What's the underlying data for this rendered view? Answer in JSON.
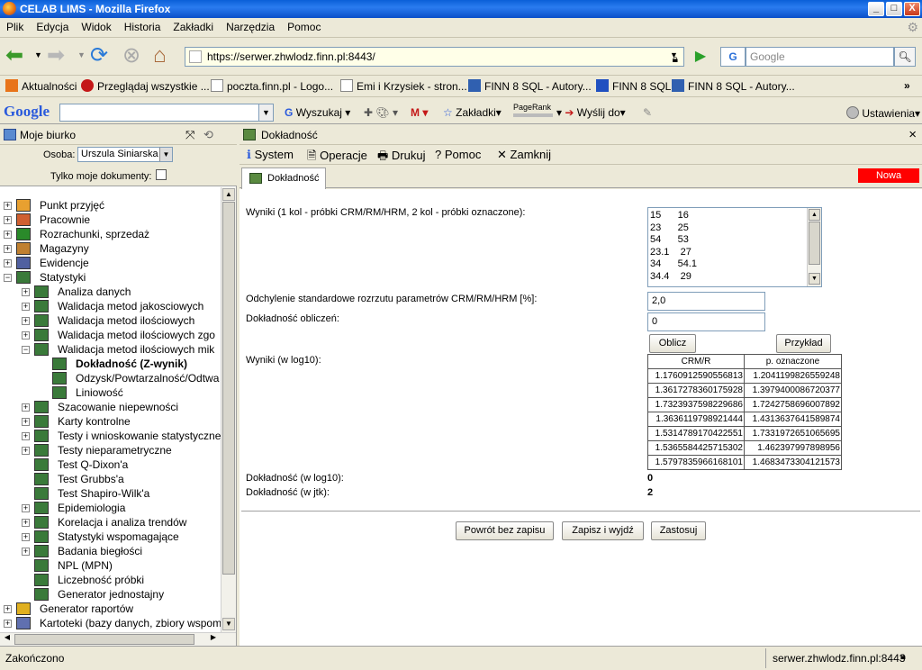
{
  "window": {
    "title": "CELAB LIMS - Mozilla Firefox",
    "min": "_",
    "max": "□",
    "close": "X"
  },
  "menu": [
    "Plik",
    "Edycja",
    "Widok",
    "Historia",
    "Zakładki",
    "Narzędzia",
    "Pomoc"
  ],
  "nav": {
    "url": "https://serwer.zhwlodz.finn.pl:8443/",
    "search_placeholder": "Google",
    "search_engine": "G"
  },
  "bookmarks": [
    {
      "label": "Aktualności",
      "icon": "rss-icon",
      "color": "#e8741a"
    },
    {
      "label": "Przeglądaj wszystkie ...",
      "icon": "finn-icon",
      "color": "#c41818"
    },
    {
      "label": "poczta.finn.pl - Logo...",
      "icon": "page-icon",
      "color": "#ffffff"
    },
    {
      "label": "Emi i Krzysiek - stron...",
      "icon": "page-icon",
      "color": "#ffffff"
    },
    {
      "label": "FINN 8 SQL - Autory...",
      "icon": "building-icon",
      "color": "#3060b0"
    },
    {
      "label": "FINN 8 SQL",
      "icon": "finn8-icon",
      "color": "#2050c0"
    },
    {
      "label": "FINN 8 SQL - Autory...",
      "icon": "building-icon",
      "color": "#3060b0"
    }
  ],
  "gtoolbar": {
    "logo": "Google",
    "search_label": "Wyszukaj",
    "bookmarks_label": "Zakładki",
    "pagerank": "PageRank",
    "send_label": "Wyślij do",
    "settings_label": "Ustawienia"
  },
  "left": {
    "title": "Moje biurko",
    "osoba_label": "Osoba:",
    "osoba_value": "Urszula Siniarska",
    "only_mine": "Tylko moje dokumenty:",
    "tree": [
      {
        "label": "Punkt przyjęć",
        "level": 0,
        "exp": "+",
        "icon": "person-icon"
      },
      {
        "label": "Pracownie",
        "level": 0,
        "exp": "+",
        "icon": "people-icon"
      },
      {
        "label": "Rozrachunki, sprzedaż",
        "level": 0,
        "exp": "+",
        "icon": "money-icon"
      },
      {
        "label": "Magazyny",
        "level": 0,
        "exp": "+",
        "icon": "box-icon"
      },
      {
        "label": "Ewidencje",
        "level": 0,
        "exp": "+",
        "icon": "records-icon"
      },
      {
        "label": "Statystyki",
        "level": 0,
        "exp": "−",
        "icon": "stats-icon"
      },
      {
        "label": "Analiza danych",
        "level": 1,
        "exp": "+",
        "icon": "stats-icon"
      },
      {
        "label": "Walidacja metod jakosciowych",
        "level": 1,
        "exp": "+",
        "icon": "stats-icon"
      },
      {
        "label": "Walidacja metod ilościowych",
        "level": 1,
        "exp": "+",
        "icon": "stats-icon"
      },
      {
        "label": "Walidacja metod ilościowych zgo",
        "level": 1,
        "exp": "+",
        "icon": "stats-icon"
      },
      {
        "label": "Walidacja metod ilościowych mik",
        "level": 1,
        "exp": "−",
        "icon": "stats-icon"
      },
      {
        "label": "Dokładność (Z-wynik)",
        "level": 2,
        "exp": "",
        "icon": "stats-icon",
        "bold": true
      },
      {
        "label": "Odzysk/Powtarzalność/Odtwa",
        "level": 2,
        "exp": "",
        "icon": "stats-icon"
      },
      {
        "label": "Liniowość",
        "level": 2,
        "exp": "",
        "icon": "stats-icon"
      },
      {
        "label": "Szacowanie niepewności",
        "level": 1,
        "exp": "+",
        "icon": "stats-icon"
      },
      {
        "label": "Karty kontrolne",
        "level": 1,
        "exp": "+",
        "icon": "stats-icon"
      },
      {
        "label": "Testy i wnioskowanie statystyczne",
        "level": 1,
        "exp": "+",
        "icon": "stats-icon"
      },
      {
        "label": "Testy nieparametryczne",
        "level": 1,
        "exp": "+",
        "icon": "stats-icon"
      },
      {
        "label": "Test Q-Dixon'a",
        "level": 1,
        "exp": "",
        "icon": "stats-icon"
      },
      {
        "label": "Test Grubbs'a",
        "level": 1,
        "exp": "",
        "icon": "stats-icon"
      },
      {
        "label": "Test Shapiro-Wilk'a",
        "level": 1,
        "exp": "",
        "icon": "stats-icon"
      },
      {
        "label": "Epidemiologia",
        "level": 1,
        "exp": "+",
        "icon": "stats-icon"
      },
      {
        "label": "Korelacja i analiza trendów",
        "level": 1,
        "exp": "+",
        "icon": "stats-icon"
      },
      {
        "label": "Statystyki wspomagające",
        "level": 1,
        "exp": "+",
        "icon": "stats-icon"
      },
      {
        "label": "Badania biegłości",
        "level": 1,
        "exp": "+",
        "icon": "stats-icon"
      },
      {
        "label": "NPL (MPN)",
        "level": 1,
        "exp": "",
        "icon": "stats-icon"
      },
      {
        "label": "Liczebność próbki",
        "level": 1,
        "exp": "",
        "icon": "stats-icon"
      },
      {
        "label": "Generator jednostajny",
        "level": 1,
        "exp": "",
        "icon": "stats-icon"
      },
      {
        "label": "Generator raportów",
        "level": 0,
        "exp": "+",
        "icon": "cross-icon"
      },
      {
        "label": "Kartoteki (bazy danych, zbiory wspom",
        "level": 0,
        "exp": "+",
        "icon": "cards-icon"
      }
    ]
  },
  "right": {
    "title": "Dokładność",
    "close": "×",
    "toolbar": [
      "System",
      "Operacje",
      "Drukuj",
      "Pomoc",
      "Zamknij"
    ],
    "tab": "Dokładność",
    "badge": "Nowa",
    "badge_color": "#ff0000",
    "wyniki_label": "Wyniki (1 kol - próbki CRM/RM/HRM, 2 kol - próbki oznaczone):",
    "wyniki_lines": [
      "15      16",
      "23      25",
      "54      53",
      "23.1    27",
      "34      54.1",
      "34.4    29"
    ],
    "odch_label": "Odchylenie standardowe rozrzutu parametrów CRM/RM/HRM [%]:",
    "odch_value": "2,0",
    "dokl_obl_label": "Dokładność obliczeń:",
    "dokl_obl_value": "0",
    "oblicz": "Oblicz",
    "przyklad": "Przykład",
    "log_label": "Wyniki (w log10):",
    "table_headers": [
      "CRM/R",
      "p. oznaczone"
    ],
    "table_rows": [
      [
        "1.1760912590556813",
        "1.2041199826559248"
      ],
      [
        "1.3617278360175928",
        "1.3979400086720377"
      ],
      [
        "1.7323937598229686",
        "1.7242758696007892"
      ],
      [
        "1.3636119798921444",
        "1.4313637641589874"
      ],
      [
        "1.5314789170422551",
        "1.7331972651065695"
      ],
      [
        "1.5365584425715302",
        "1.462397997898956"
      ],
      [
        "1.5797835966168101",
        "1.4683473304121573"
      ]
    ],
    "dokl_log_label": "Dokładność (w log10):",
    "dokl_log_value": "0",
    "dokl_jtk_label": "Dokładność (w jtk):",
    "dokl_jtk_value": "2",
    "btn_back": "Powrót bez zapisu",
    "btn_save": "Zapisz i wyjdź",
    "btn_apply": "Zastosuj"
  },
  "status": {
    "left": "Zakończono",
    "right": "serwer.zhwlodz.finn.pl:8443"
  }
}
